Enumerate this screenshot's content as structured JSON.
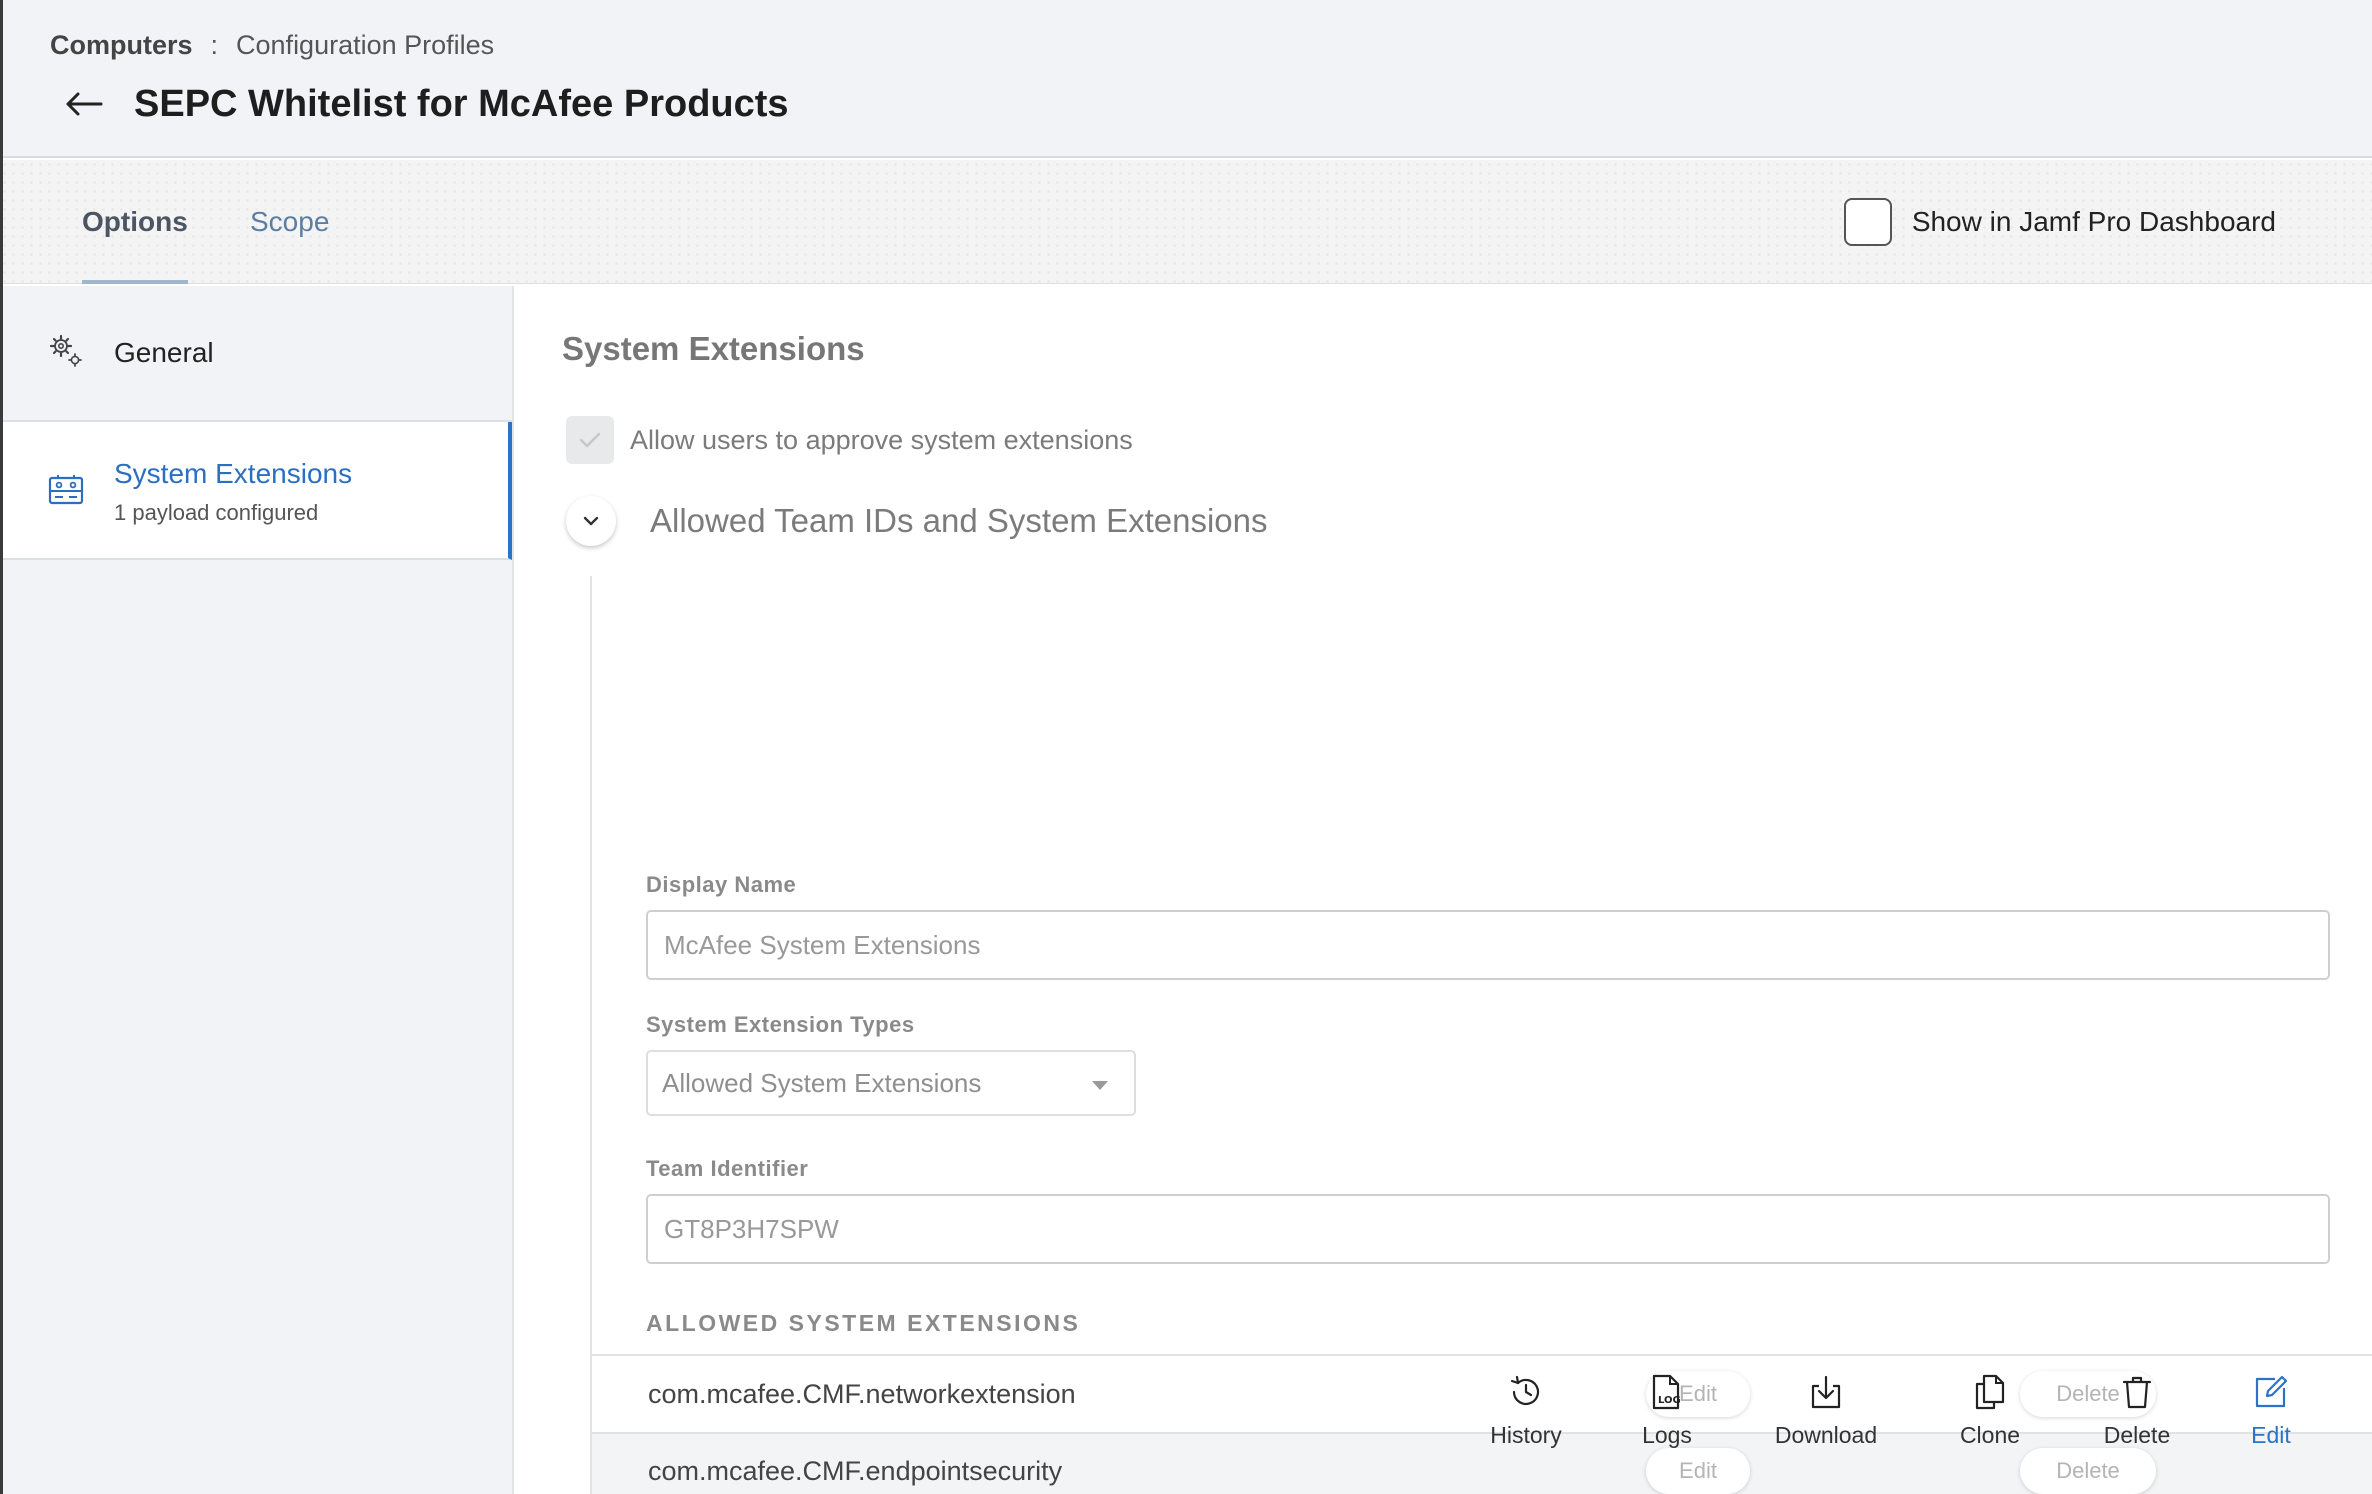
{
  "breadcrumb": {
    "section": "Computers",
    "separator": ":",
    "page": "Configuration Profiles"
  },
  "header": {
    "title": "SEPC Whitelist for McAfee Products"
  },
  "tabs": [
    {
      "label": "Options",
      "active": true
    },
    {
      "label": "Scope",
      "active": false
    }
  ],
  "dashboard_toggle": {
    "label": "Show in Jamf Pro Dashboard",
    "checked": false
  },
  "sidebar": {
    "items": [
      {
        "label": "General",
        "icon": "gear-icon"
      },
      {
        "label": "System Extensions",
        "sublabel": "1 payload configured",
        "icon": "system-extension-icon",
        "active": true
      }
    ]
  },
  "main": {
    "section_title": "System Extensions",
    "allow_users": {
      "label": "Allow users to approve system extensions",
      "checked": true
    },
    "group": {
      "title": "Allowed Team IDs and System Extensions",
      "display_name": {
        "label": "Display Name",
        "value": "McAfee System Extensions"
      },
      "extension_types": {
        "label": "System Extension Types",
        "value": "Allowed System Extensions"
      },
      "team_identifier": {
        "label": "Team Identifier",
        "value": "GT8P3H7SPW"
      },
      "allowed_header": "ALLOWED SYSTEM EXTENSIONS",
      "extensions": [
        {
          "name": "com.mcafee.CMF.networkextension",
          "edit": "Edit",
          "delete": "Delete"
        },
        {
          "name": "com.mcafee.CMF.endpointsecurity",
          "edit": "Edit",
          "delete": "Delete"
        }
      ]
    }
  },
  "actions": [
    {
      "label": "History",
      "icon": "history-icon"
    },
    {
      "label": "Logs",
      "icon": "logs-icon"
    },
    {
      "label": "Download",
      "icon": "download-icon"
    },
    {
      "label": "Clone",
      "icon": "clone-icon"
    },
    {
      "label": "Delete",
      "icon": "trash-icon"
    },
    {
      "label": "Edit",
      "icon": "edit-icon"
    }
  ],
  "colors": {
    "accent": "#2a73c8",
    "tab_scope": "#5c7ea3",
    "tab_underline": "#9fb6cd"
  }
}
